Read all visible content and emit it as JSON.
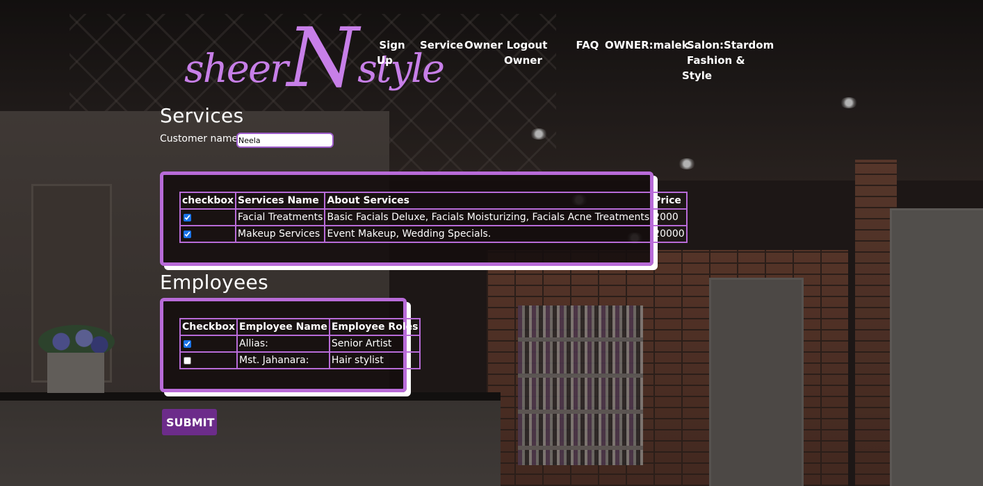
{
  "brand": {
    "logo_text_left": "sheer",
    "logo_letter": "N",
    "logo_text_right": "style",
    "logo_color": "#c77fe8"
  },
  "nav": {
    "sign_up": [
      "Sign",
      "Up"
    ],
    "service": "Service",
    "owner": "Owner",
    "logout_owner": [
      "Logout",
      "Owner"
    ],
    "faq": "FAQ",
    "owner_name": "OWNER:malek",
    "salon": [
      "Salon:Stardom Fashion &",
      "Style"
    ]
  },
  "services_section": {
    "heading": "Services",
    "customer_label": "Customer name:",
    "customer_value": "Neela",
    "columns": [
      "checkbox",
      "Services Name",
      "About Services",
      "Price"
    ],
    "rows": [
      {
        "checked": true,
        "name": "Facial Treatments",
        "about": "Basic Facials Deluxe, Facials Moisturizing, Facials Acne Treatments",
        "price": "2000"
      },
      {
        "checked": true,
        "name": "Makeup Services",
        "about": "Event Makeup, Wedding Specials.",
        "price": "20000"
      }
    ]
  },
  "employees_section": {
    "heading": "Employees",
    "columns": [
      "Checkbox",
      "Employee Name",
      "Employee Roles"
    ],
    "rows": [
      {
        "checked": true,
        "name": "Allias:",
        "role": "Senior Artist"
      },
      {
        "checked": false,
        "name": "Mst. Jahanara:",
        "role": "Hair stylist"
      }
    ]
  },
  "submit_label": "SUBMIT",
  "colors": {
    "accent_border": "#b86bd8",
    "submit_bg": "#6c2c8a"
  }
}
